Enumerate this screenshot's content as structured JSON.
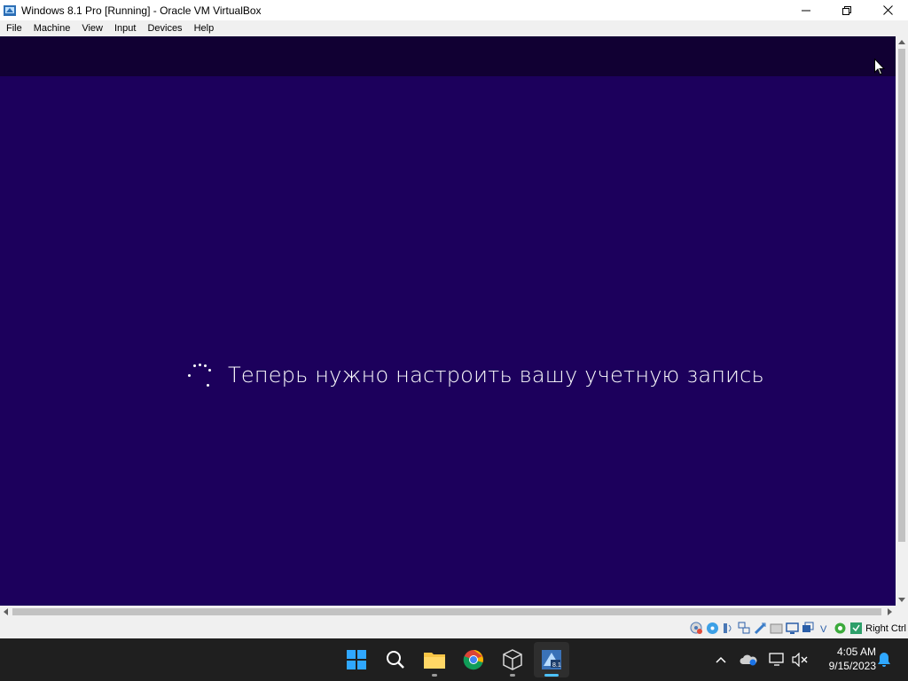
{
  "window": {
    "title": "Windows 8.1 Pro [Running] - Oracle VM VirtualBox",
    "icon": "virtualbox-vm-icon",
    "controls": [
      "minimize-icon",
      "maximize-icon",
      "close-icon"
    ]
  },
  "menubar": {
    "items": [
      "File",
      "Machine",
      "View",
      "Input",
      "Devices",
      "Help"
    ]
  },
  "guest": {
    "background_color": "#1c005c",
    "message": "Теперь нужно настроить вашу учетную запись",
    "spinner": "loading-spinner-icon"
  },
  "statusbar": {
    "icons": [
      "hard-disk-icon",
      "optical-drive-icon",
      "audio-icon",
      "network-icon",
      "usb-icon",
      "shared-folders-icon",
      "display-icon",
      "video-capture-icon",
      "virtualization-icon",
      "cpu-icon",
      "mouse-integration-icon"
    ],
    "host_key": "Right Ctrl"
  },
  "taskbar": {
    "apps": [
      {
        "name": "start-icon"
      },
      {
        "name": "search-icon"
      },
      {
        "name": "file-explorer-icon"
      },
      {
        "name": "chrome-icon"
      },
      {
        "name": "virtualbox-manager-icon"
      },
      {
        "name": "virtualbox-vm-window-icon",
        "active": true
      }
    ],
    "tray": [
      "chevron-up-icon",
      "onedrive-icon",
      "network-icon",
      "volume-muted-icon"
    ],
    "time": "4:05 AM",
    "date": "9/15/2023",
    "notification": "bell-icon",
    "accent_color": "#4cc2ff"
  }
}
